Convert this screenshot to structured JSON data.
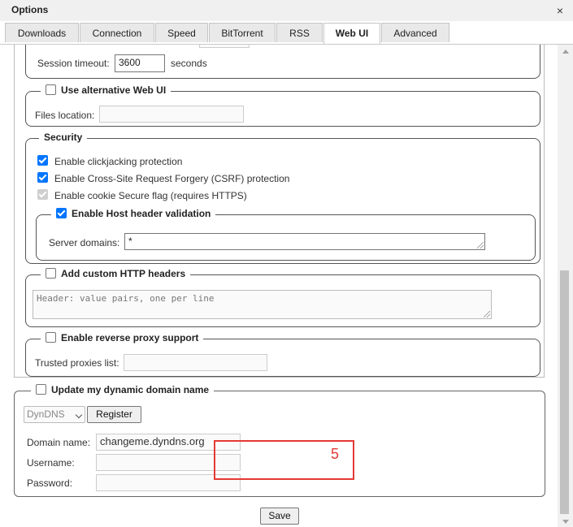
{
  "window": {
    "title": "Options",
    "close_glyph": "×"
  },
  "tabs": [
    {
      "label": "Downloads"
    },
    {
      "label": "Connection"
    },
    {
      "label": "Speed"
    },
    {
      "label": "BitTorrent"
    },
    {
      "label": "RSS"
    },
    {
      "label": "Web UI",
      "active": true
    },
    {
      "label": "Advanced"
    }
  ],
  "session": {
    "label": "Session timeout:",
    "value": "3600",
    "unit": "seconds"
  },
  "alt_webui": {
    "legend": "Use alternative Web UI",
    "checked": false,
    "files_location_label": "Files location:",
    "files_location_value": ""
  },
  "security": {
    "legend": "Security",
    "clickjacking": {
      "label": "Enable clickjacking protection",
      "checked": true
    },
    "csrf": {
      "label": "Enable Cross-Site Request Forgery (CSRF) protection",
      "checked": true
    },
    "cookie_secure": {
      "label": "Enable cookie Secure flag (requires HTTPS)",
      "checked": true,
      "disabled": true
    },
    "host_header": {
      "legend": "Enable Host header validation",
      "checked": true,
      "server_domains_label": "Server domains:",
      "server_domains_value": "*"
    }
  },
  "custom_headers": {
    "legend": "Add custom HTTP headers",
    "checked": false,
    "placeholder": "Header: value pairs, one per line"
  },
  "reverse_proxy": {
    "legend": "Enable reverse proxy support",
    "checked": false,
    "trusted_label": "Trusted proxies list:",
    "trusted_value": ""
  },
  "dyndns": {
    "legend": "Update my dynamic domain name",
    "checked": false,
    "service_selected": "DynDNS",
    "register_label": "Register",
    "domain_label": "Domain name:",
    "domain_value": "changeme.dyndns.org",
    "username_label": "Username:",
    "username_value": "",
    "password_label": "Password:",
    "password_value": ""
  },
  "save_label": "Save",
  "annotation": {
    "number": "5",
    "color": "#e53935"
  },
  "colors": {
    "checkbox_accent": "#0075ff",
    "annotation": "#e53935"
  }
}
